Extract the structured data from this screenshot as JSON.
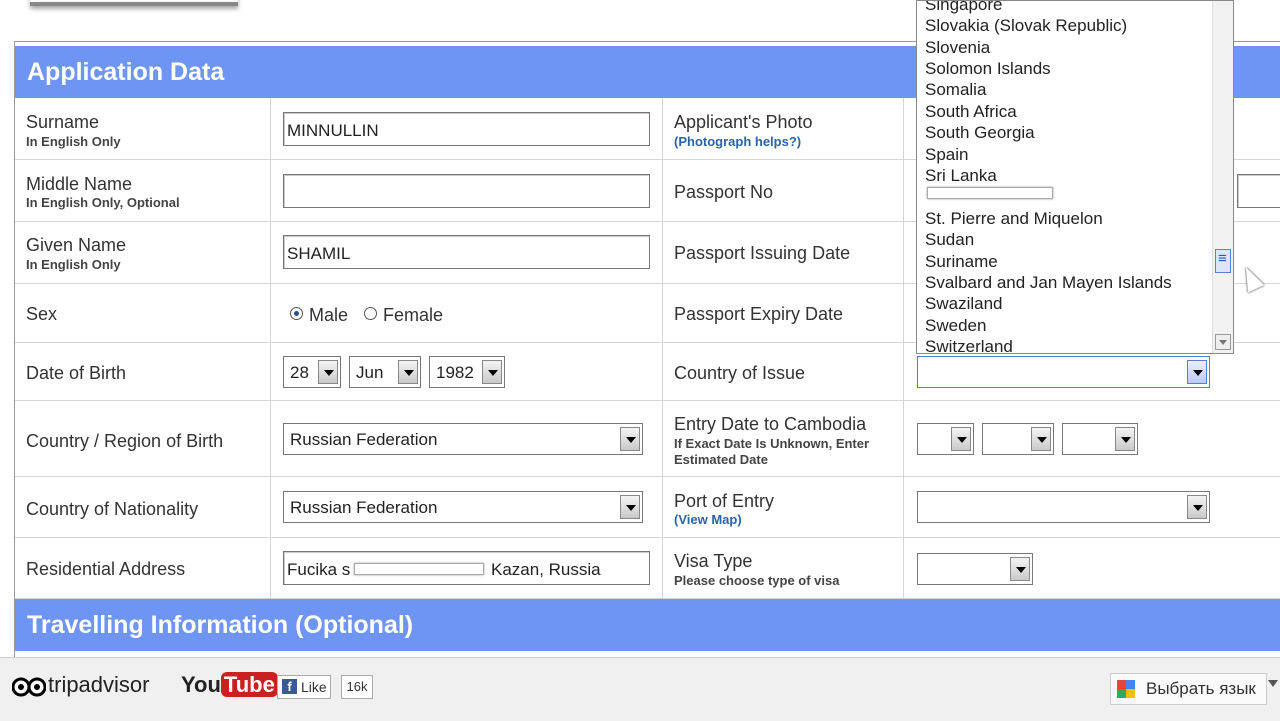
{
  "section1_title": "Application Data",
  "section2_title": "Travelling Information (Optional)",
  "left_rows": [
    {
      "label": "Surname",
      "sub": "In English Only"
    },
    {
      "label": "Middle Name",
      "sub": "In English Only, Optional"
    },
    {
      "label": "Given Name",
      "sub": "In English Only"
    },
    {
      "label": "Sex",
      "sub": ""
    },
    {
      "label": "Date of Birth",
      "sub": ""
    },
    {
      "label": "Country / Region of Birth",
      "sub": ""
    },
    {
      "label": "Country of Nationality",
      "sub": ""
    },
    {
      "label": "Residential Address",
      "sub": ""
    }
  ],
  "fields": {
    "surname": "MINNULLIN",
    "middle_name": "",
    "given_name": "SHAMIL",
    "sex_male": "Male",
    "sex_female": "Female",
    "dob_day": "28",
    "dob_month": "Jun",
    "dob_year": "1982",
    "country_birth": "Russian Federation",
    "nationality": "Russian Federation",
    "address_prefix": "Fucika s",
    "address_suffix": "Kazan, Russia"
  },
  "right_rows": {
    "photo_label": "Applicant's Photo",
    "photo_link": "(Photograph helps?)",
    "passport_no": "Passport No",
    "passport_issuing": "Passport Issuing Date",
    "passport_expiry": "Passport Expiry Date",
    "country_issue": "Country of Issue",
    "entry_date": "Entry Date to Cambodia",
    "entry_date_sub1": "If Exact Date Is Unknown, Enter",
    "entry_date_sub2": "Estimated Date",
    "port_entry": "Port of Entry",
    "view_map": "(View Map)",
    "visa_type": "Visa Type",
    "visa_type_sub": "Please choose type of visa"
  },
  "dropdown_options": [
    "Singapore",
    "Slovakia (Slovak Republic)",
    "Slovenia",
    "Solomon Islands",
    "Somalia",
    "South Africa",
    "South Georgia",
    "Spain",
    "Sri Lanka",
    "",
    "St. Pierre and Miquelon",
    "Sudan",
    "Suriname",
    "Svalbard and Jan Mayen Islands",
    "Swaziland",
    "Sweden",
    "Switzerland"
  ],
  "footer": {
    "tripadvisor": "tripadvisor",
    "youtube_you": "You",
    "youtube_tube": "Tube",
    "fb_like": "Like",
    "like_count": "16k",
    "translate": "Выбрать язык"
  },
  "colors": {
    "header_blue": "#6f95f4"
  }
}
